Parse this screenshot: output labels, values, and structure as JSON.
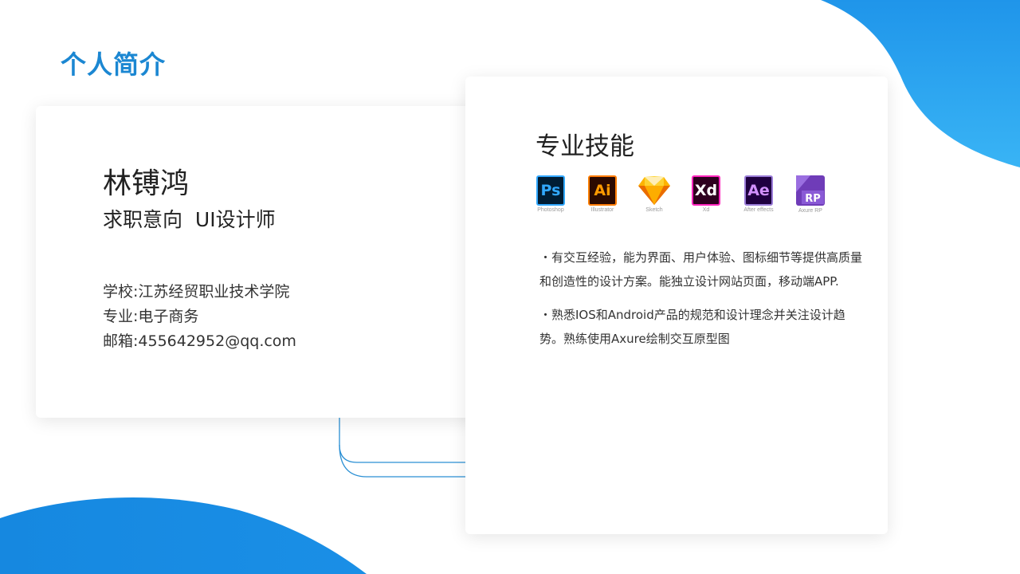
{
  "page": {
    "title": "个人简介"
  },
  "profile": {
    "name": "林镈鸿",
    "intent": "求职意向  UI设计师",
    "info": [
      "学校:江苏经贸职业技术学院",
      "专业:电子商务",
      "邮箱:455642952@qq.com"
    ]
  },
  "skills": {
    "title": "专业技能",
    "tools": [
      {
        "icon": "photoshop-icon",
        "mark": "Ps",
        "label": "Photoshop",
        "bg": "#001d34",
        "fg": "#31a8ff"
      },
      {
        "icon": "illustrator-icon",
        "mark": "Ai",
        "label": "Illustrator",
        "bg": "#2c0a00",
        "fg": "#ff7c00"
      },
      {
        "icon": "sketch-icon",
        "mark": "",
        "label": "Sketch",
        "bg": "#f7b500",
        "fg": "#fdad00"
      },
      {
        "icon": "xd-icon",
        "mark": "Xd",
        "label": "Xd",
        "bg": "#2e001f",
        "fg": "#ff26be"
      },
      {
        "icon": "after-effects-icon",
        "mark": "Ae",
        "label": "After effects",
        "bg": "#1f0040",
        "fg": "#d291ff"
      },
      {
        "icon": "axure-rp-icon",
        "mark": "RP",
        "label": "Axure RP",
        "bg": "#6f3cb8",
        "fg": "#ffffff"
      }
    ],
    "descriptions": [
      "・有交互经验，能为界面、用户体验、图标细节等提供高质量和创造性的设计方案。能独立设计网站页面，移动端APP.",
      "・熟悉IOS和Android产品的规范和设计理念并关注设计趋势。熟练使用Axure绘制交互原型图"
    ]
  },
  "colors": {
    "accent": "#1b87d2",
    "blob": "#1c8fe3"
  }
}
